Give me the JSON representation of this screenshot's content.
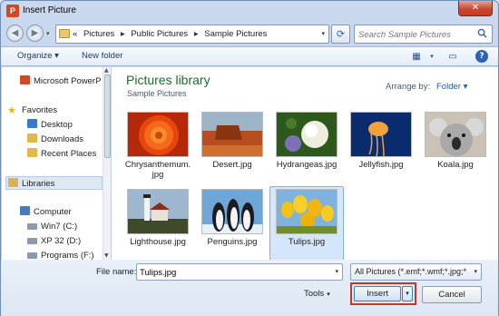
{
  "window": {
    "title": "Insert Picture",
    "app_icon_letter": "P",
    "close_glyph": "✕"
  },
  "nav": {
    "back_glyph": "◀",
    "forward_glyph": "▶",
    "dropdown_glyph": "▾"
  },
  "address": {
    "prefix": "«",
    "crumbs": [
      "Pictures",
      "Public Pictures",
      "Sample Pictures"
    ],
    "separator": "▸"
  },
  "search": {
    "placeholder": "Search Sample Pictures"
  },
  "toolbar": {
    "organize_label": "Organize ▾",
    "new_folder_label": "New folder"
  },
  "sidebar": {
    "items": [
      {
        "label": "Microsoft PowerP",
        "icon": "powerpoint-icon",
        "color": "#d24726"
      },
      {
        "label": "Favorites",
        "icon": "star-icon",
        "color": "#f0b400"
      },
      {
        "label": "Desktop",
        "icon": "desktop-icon",
        "color": "#3a78c9"
      },
      {
        "label": "Downloads",
        "icon": "downloads-icon",
        "color": "#e2b84d"
      },
      {
        "label": "Recent Places",
        "icon": "recent-places-icon",
        "color": "#e2b84d"
      },
      {
        "label": "Libraries",
        "icon": "libraries-icon",
        "color": "#d8b25a"
      },
      {
        "label": "Computer",
        "icon": "computer-icon",
        "color": "#4a7bb8"
      },
      {
        "label": "Win7 (C:)",
        "icon": "drive-icon",
        "color": "#8e9aab"
      },
      {
        "label": "XP 32 (D:)",
        "icon": "drive-icon",
        "color": "#8e9aab"
      },
      {
        "label": "Programs (F:)",
        "icon": "drive-icon",
        "color": "#8e9aab"
      }
    ]
  },
  "library": {
    "title": "Pictures library",
    "subtitle": "Sample Pictures",
    "arrange_label": "Arrange by:",
    "arrange_value": "Folder ▾"
  },
  "files": [
    {
      "line1": "Chrysanthemum.",
      "line2": "jpg",
      "selected": false
    },
    {
      "line1": "Desert.jpg",
      "line2": "",
      "selected": false
    },
    {
      "line1": "Hydrangeas.jpg",
      "line2": "",
      "selected": false
    },
    {
      "line1": "Jellyfish.jpg",
      "line2": "",
      "selected": false
    },
    {
      "line1": "Koala.jpg",
      "line2": "",
      "selected": false
    },
    {
      "line1": "Lighthouse.jpg",
      "line2": "",
      "selected": false
    },
    {
      "line1": "Penguins.jpg",
      "line2": "",
      "selected": false
    },
    {
      "line1": "Tulips.jpg",
      "line2": "",
      "selected": true
    }
  ],
  "footer": {
    "file_name_label": "File name:",
    "file_name_value": "Tulips.jpg",
    "filter_value": "All Pictures (*.emf;*.wmf;*.jpg;*",
    "tools_label": "Tools",
    "insert_label": "Insert",
    "cancel_label": "Cancel"
  }
}
